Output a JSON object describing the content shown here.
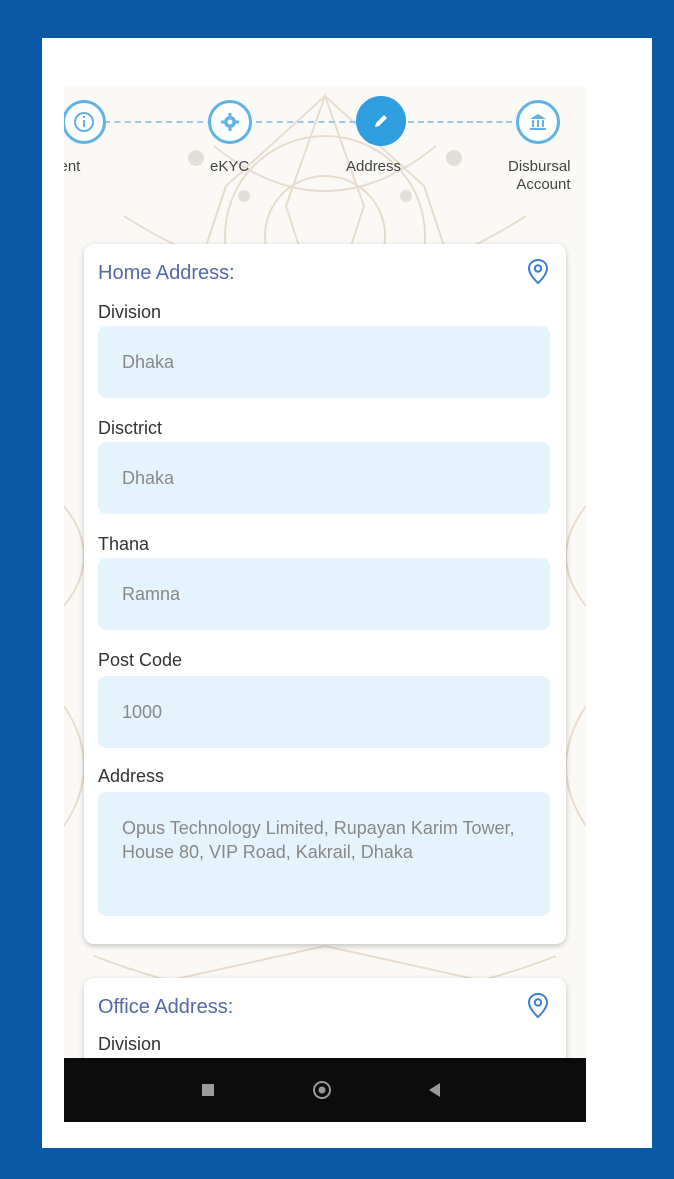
{
  "stepper": {
    "steps": [
      {
        "label": "sent",
        "icon": "info-icon"
      },
      {
        "label": "eKYC",
        "icon": "gear-icon"
      },
      {
        "label": "Address",
        "icon": "pencil-icon",
        "active": true
      },
      {
        "label": "Disbursal\nAccount",
        "icon": "bank-icon"
      }
    ]
  },
  "home": {
    "title": "Home Address:",
    "division_label": "Division",
    "division_value": "Dhaka",
    "district_label": "Disctrict",
    "district_value": "Dhaka",
    "thana_label": "Thana",
    "thana_value": "Ramna",
    "postcode_label": "Post Code",
    "postcode_value": "1000",
    "address_label": "Address",
    "address_value": "Opus Technology Limited, Rupayan Karim Tower, House 80, VIP Road, Kakrail, Dhaka"
  },
  "office": {
    "title": "Office Address:",
    "division_label": "Division"
  },
  "colors": {
    "frame_blue": "#0a58a4",
    "accent": "#2f9fe0",
    "title_color": "#5468a8",
    "field_bg": "#e4f3fc"
  }
}
